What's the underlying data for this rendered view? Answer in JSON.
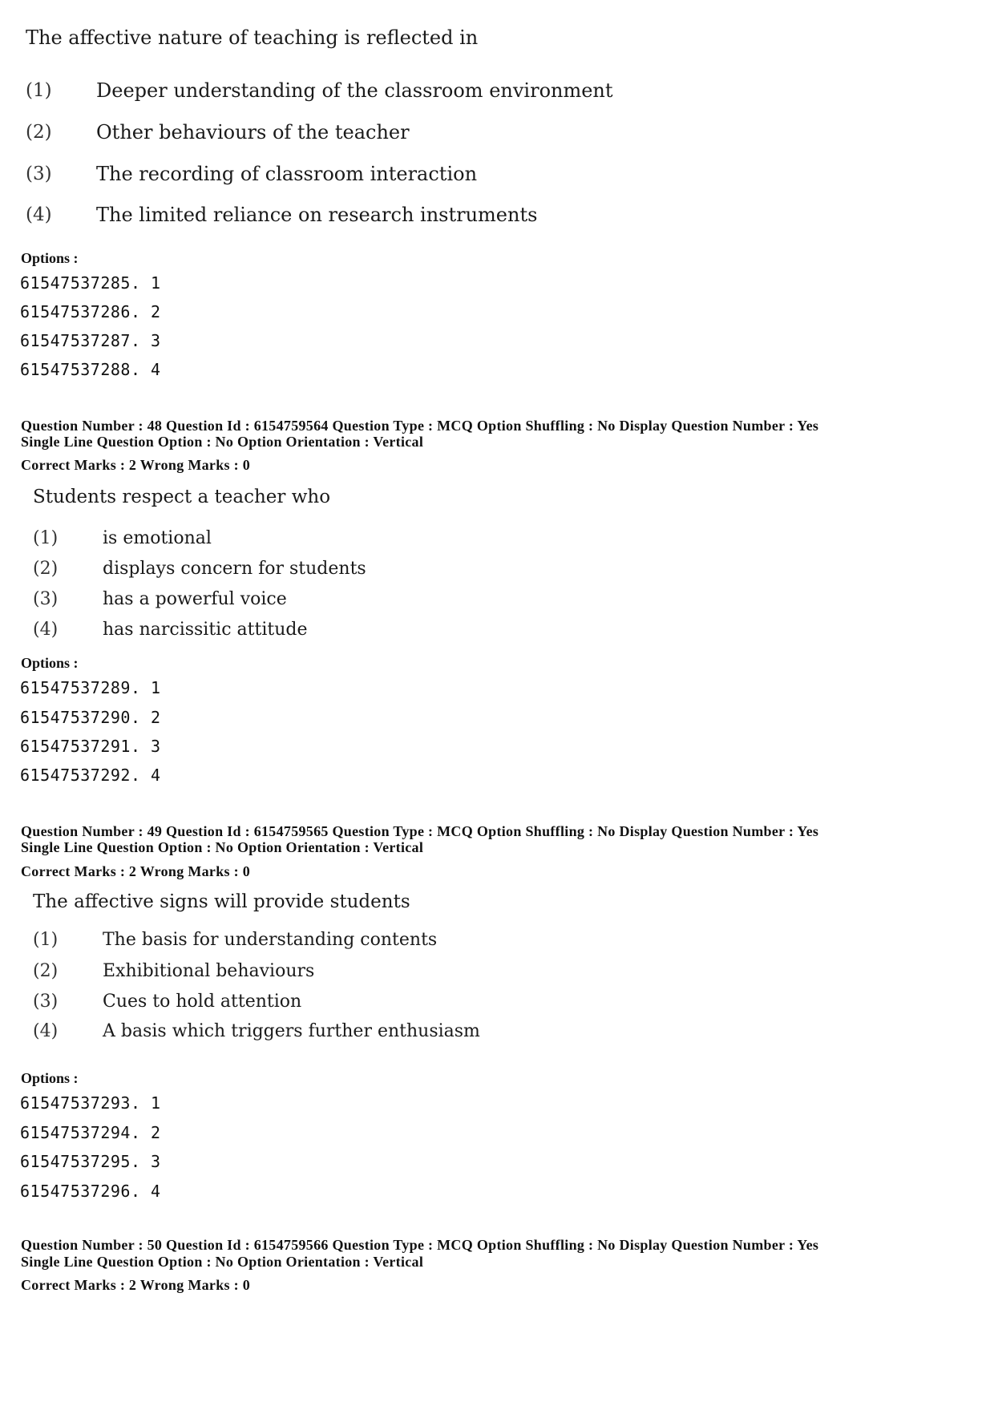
{
  "questions": [
    {
      "stem": "The affective nature of teaching is reflected in",
      "choices": [
        {
          "num": "(1)",
          "text": "Deeper understanding of the classroom environment"
        },
        {
          "num": "(2)",
          "text": "Other behaviours of the teacher"
        },
        {
          "num": "(3)",
          "text": "The recording of classroom interaction"
        },
        {
          "num": "(4)",
          "text": "The limited reliance on research instruments"
        }
      ],
      "options_label": "Options :",
      "option_ids": [
        "61547537285. 1",
        "61547537286. 2",
        "61547537287. 3",
        "61547537288. 4"
      ]
    },
    {
      "meta_line1": "Question Number : 48  Question Id : 6154759564  Question Type : MCQ  Option Shuffling : No  Display Question Number : Yes",
      "meta_line2": "Single Line Question Option : No  Option Orientation : Vertical",
      "marks": "Correct Marks : 2  Wrong Marks : 0",
      "stem": "Students respect a teacher who",
      "choices": [
        {
          "num": "(1)",
          "text": "is emotional"
        },
        {
          "num": "(2)",
          "text": "displays concern for students"
        },
        {
          "num": "(3)",
          "text": "has a powerful voice"
        },
        {
          "num": "(4)",
          "text": "has narcissitic attitude"
        }
      ],
      "options_label": "Options :",
      "option_ids": [
        "61547537289. 1",
        "61547537290. 2",
        "61547537291. 3",
        "61547537292. 4"
      ]
    },
    {
      "meta_line1": "Question Number : 49  Question Id : 6154759565  Question Type : MCQ  Option Shuffling : No  Display Question Number : Yes",
      "meta_line2": "Single Line Question Option : No  Option Orientation : Vertical",
      "marks": "Correct Marks : 2  Wrong Marks : 0",
      "stem": "The affective signs will provide students",
      "choices": [
        {
          "num": "(1)",
          "text": "The basis for understanding contents"
        },
        {
          "num": "(2)",
          "text": "Exhibitional behaviours"
        },
        {
          "num": "(3)",
          "text": "Cues to hold attention"
        },
        {
          "num": "(4)",
          "text": "A basis which triggers further enthusiasm"
        }
      ],
      "options_label": "Options :",
      "option_ids": [
        "61547537293. 1",
        "61547537294. 2",
        "61547537295. 3",
        "61547537296. 4"
      ]
    },
    {
      "meta_line1": "Question Number : 50  Question Id : 6154759566  Question Type : MCQ  Option Shuffling : No  Display Question Number : Yes",
      "meta_line2": "Single Line Question Option : No  Option Orientation : Vertical",
      "marks": "Correct Marks : 2  Wrong Marks : 0"
    }
  ]
}
